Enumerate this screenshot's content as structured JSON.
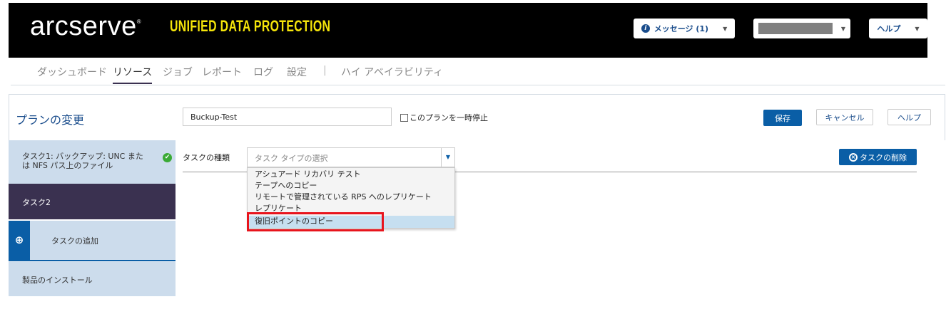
{
  "header": {
    "logo": "arcserve",
    "logo_mark": "®",
    "product": "UNIFIED DATA PROTECTION",
    "messages_label": "メッセージ (1)",
    "help_label": "ヘルプ"
  },
  "nav": {
    "items": [
      "ダッシュボード",
      "リソース",
      "ジョブ",
      "レポート",
      "ログ",
      "設定",
      "ハイ アベイラビリティ"
    ],
    "active": "リソース",
    "separator": "|"
  },
  "plan": {
    "title": "プランの変更",
    "name_value": "Buckup-Test",
    "pause_label": "このプランを一時停止",
    "pause_checked": false,
    "save": "保存",
    "cancel": "キャンセル",
    "help": "ヘルプ"
  },
  "sidebar": {
    "task1": "タスク1: バックアップ: UNC または NFS パス上のファイル",
    "task2": "タスク2",
    "add_task": "タスクの追加",
    "install": "製品のインストール"
  },
  "task": {
    "type_label": "タスクの種類",
    "select_placeholder": "タスク タイプの選択",
    "delete": "タスクの削除",
    "options": [
      "アシュアード リカバリ テスト",
      "テープへのコピー",
      "リモートで管理されている RPS へのレプリケート",
      "レプリケート",
      "復旧ポイントのコピー"
    ],
    "highlighted": "復旧ポイントのコピー"
  },
  "colors": {
    "accent": "#0a5ea6",
    "header_bg": "#000000",
    "brand_yellow": "#f5e50a",
    "sidebar_dark": "#3a3150",
    "sidebar_light": "#ccdcec",
    "highlight_box": "#e8141c"
  }
}
